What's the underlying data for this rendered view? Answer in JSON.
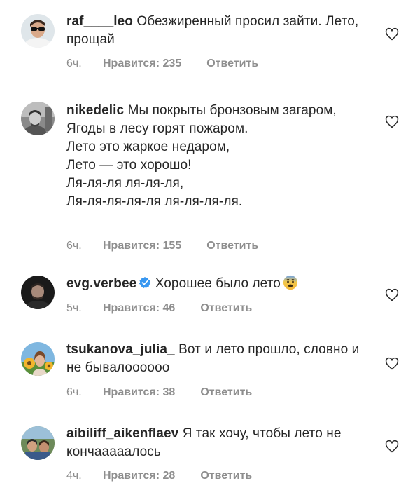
{
  "colors": {
    "text": "#262626",
    "meta": "#8e8e8e",
    "verified": "#3897f0",
    "background": "#ffffff"
  },
  "comments": [
    {
      "username": "raf____leo",
      "text": "Обезжиренный просил зайти. Лето, прощай",
      "time": "6ч.",
      "likes": "Нравится: 235",
      "reply": "Ответить",
      "icon": "heart-outline-icon"
    },
    {
      "username": "nikedelic",
      "text": "Мы покрыты бронзовым загаром,\nЯгоды в лесу горят пожаром.\nЛето это жаркое недаром,\nЛето — это хорошо!\nЛя-ля-ля ля-ля-ля,\nЛя-ля-ля-ля-ля ля-ля-ля-ля.",
      "time": "6ч.",
      "likes": "Нравится: 155",
      "reply": "Ответить",
      "icon": "heart-outline-icon"
    },
    {
      "username": "evg.verbee",
      "verified": true,
      "text": "Хорошее было лето",
      "emoji": "anxious-face-emoji",
      "time": "5ч.",
      "likes": "Нравится: 46",
      "reply": "Ответить",
      "icon": "heart-outline-icon"
    },
    {
      "username": "tsukanova_julia_",
      "text": "Вот и лето прошло, словно и не бывалоооооо",
      "time": "6ч.",
      "likes": "Нравится: 38",
      "reply": "Ответить",
      "icon": "heart-outline-icon"
    },
    {
      "username": "aibiliff_aikenflaev",
      "text": "Я так хочу, чтобы лето не кончааааалось",
      "time": "4ч.",
      "likes": "Нравится: 28",
      "reply": "Ответить",
      "icon": "heart-outline-icon"
    }
  ]
}
